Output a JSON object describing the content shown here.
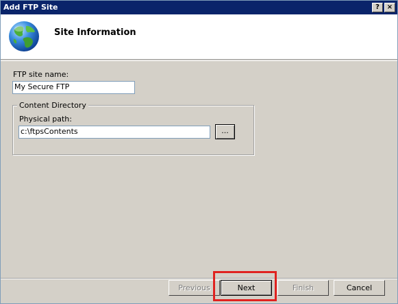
{
  "window": {
    "title": "Add FTP Site",
    "help_button": "?",
    "close_button": "×"
  },
  "header": {
    "heading": "Site Information",
    "icon": "globe-icon"
  },
  "form": {
    "site_name_label": "FTP site name:",
    "site_name_value": "My Secure FTP",
    "content_group_label": "Content Directory",
    "physical_path_label": "Physical path:",
    "physical_path_value": "c:\\ftpsContents",
    "browse_label": "..."
  },
  "footer": {
    "previous_label": "Previous",
    "next_label": "Next",
    "finish_label": "Finish",
    "cancel_label": "Cancel"
  },
  "colors": {
    "titlebar": "#0a246a",
    "highlight": "#e0221f",
    "dialog_bg": "#d4d0c8"
  }
}
